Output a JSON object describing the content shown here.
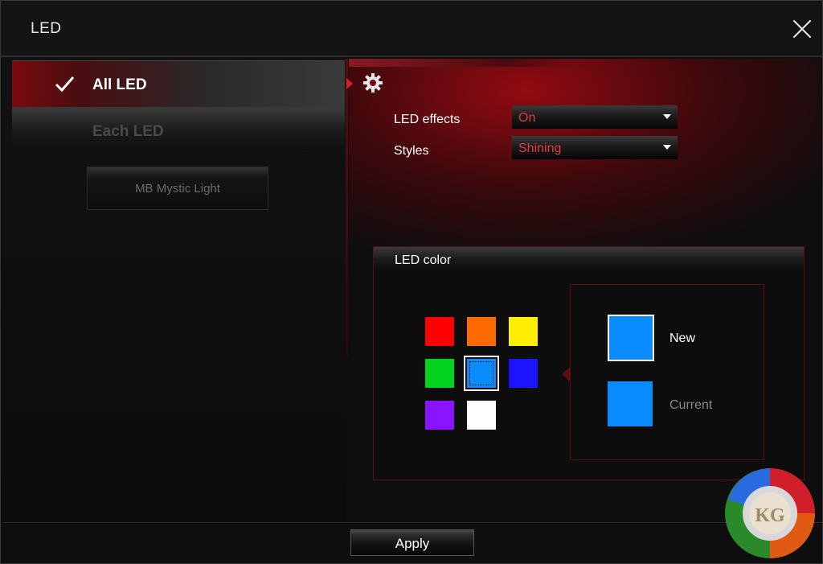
{
  "window": {
    "title": "LED"
  },
  "sidebar": {
    "items": [
      {
        "label": "All LED",
        "selected": true
      },
      {
        "label": "Each LED",
        "selected": false
      }
    ],
    "mystic_button": "MB Mystic Light"
  },
  "settings": {
    "led_effects": {
      "label": "LED effects",
      "value": "On"
    },
    "styles": {
      "label": "Styles",
      "value": "Shining"
    }
  },
  "led_color": {
    "title": "LED color",
    "swatches": [
      {
        "name": "red",
        "color": "#ff0000"
      },
      {
        "name": "orange",
        "color": "#ff6a00"
      },
      {
        "name": "yellow",
        "color": "#ffee00"
      },
      {
        "name": "green",
        "color": "#00d21e"
      },
      {
        "name": "light-blue",
        "color": "#0a8cff",
        "selected": true
      },
      {
        "name": "blue",
        "color": "#1a14ff"
      },
      {
        "name": "purple",
        "color": "#8a14ff"
      },
      {
        "name": "white",
        "color": "#ffffff"
      }
    ],
    "new_label": "New",
    "new_color": "#0a8cff",
    "current_label": "Current",
    "current_color": "#0a8cff"
  },
  "footer": {
    "apply_label": "Apply"
  },
  "logo": {
    "text": "KG"
  },
  "colors": {
    "accent": "#c8101a",
    "dropdown_text": "#e43a3a"
  }
}
